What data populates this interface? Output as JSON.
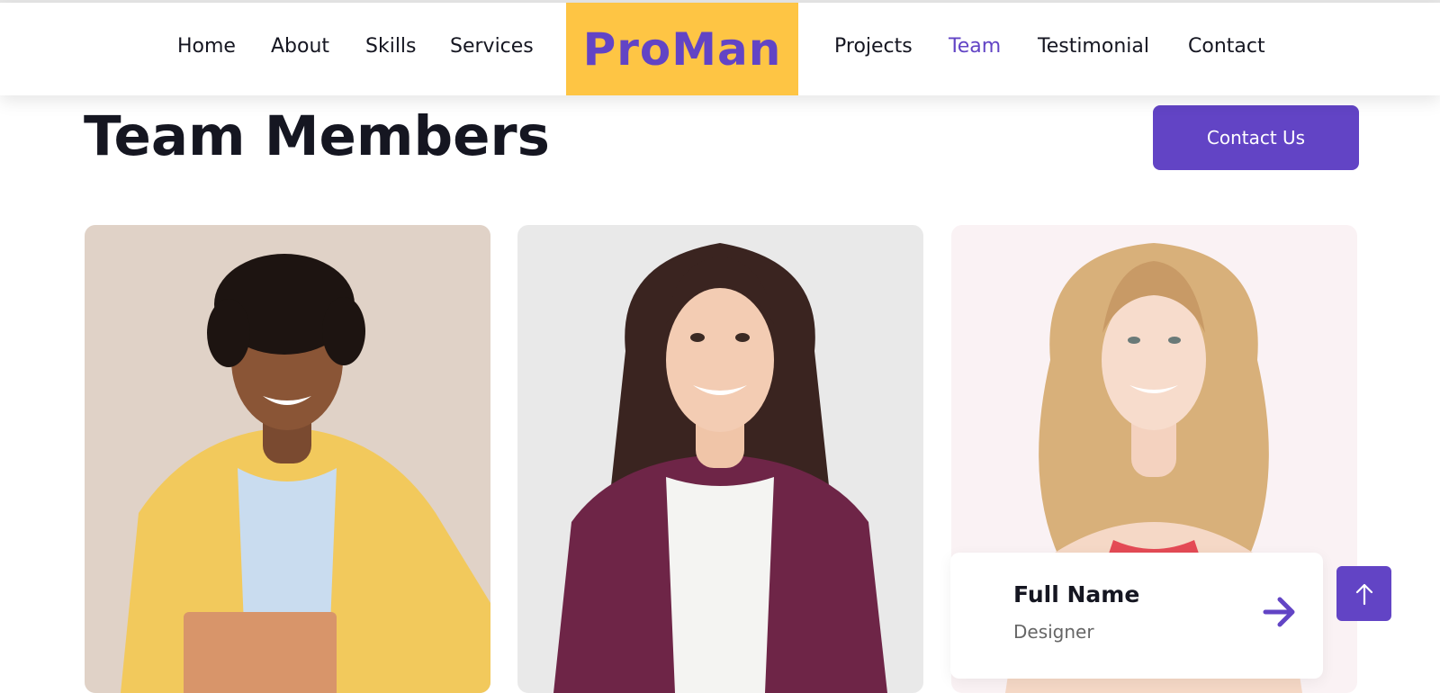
{
  "nav": {
    "left_items": [
      {
        "label": "Home"
      },
      {
        "label": "About"
      },
      {
        "label": "Skills"
      },
      {
        "label": "Services"
      }
    ],
    "logo": "ProMan",
    "right_items": [
      {
        "label": "Projects"
      },
      {
        "label": "Team",
        "active": true
      },
      {
        "label": "Testimonial"
      },
      {
        "label": "Contact"
      }
    ]
  },
  "section": {
    "title": "Team Members",
    "cta_label": "Contact Us"
  },
  "team": {
    "featured": {
      "name": "Full Name",
      "role": "Designer"
    }
  },
  "icons": {
    "card_arrow": "arrow-right-icon",
    "back_to_top": "arrow-up-icon"
  },
  "colors": {
    "primary": "#6244c5",
    "accent": "#fec544",
    "dark": "#151621"
  }
}
